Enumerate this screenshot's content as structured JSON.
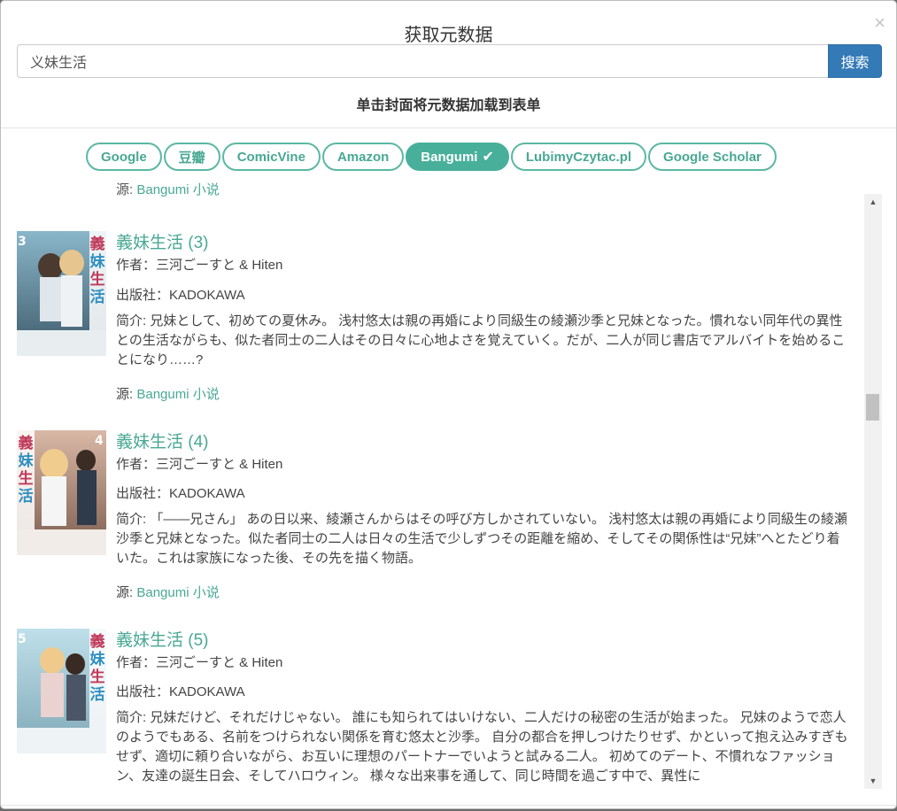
{
  "dialog": {
    "title": "获取元数据",
    "close": "×"
  },
  "search": {
    "value": "义妹生活",
    "button_label": "搜索"
  },
  "hint": "单击封面将元数据加载到表单",
  "sources": [
    {
      "label": "Google",
      "active": false
    },
    {
      "label": "豆瓣",
      "active": false
    },
    {
      "label": "ComicVine",
      "active": false
    },
    {
      "label": "Amazon",
      "active": false
    },
    {
      "label": "Bangumi",
      "active": true
    },
    {
      "label": "LubimyCzytac.pl",
      "active": false
    },
    {
      "label": "Google Scholar",
      "active": false
    }
  ],
  "partial": {
    "source_label": "源: ",
    "source_link": "Bangumi 小说"
  },
  "results": [
    {
      "title": "義妹生活 (3)",
      "author": "作者：三河ごーすと & Hiten",
      "publisher": "出版社：KADOKAWA",
      "description": "简介: 兄妹として、初めての夏休み。 浅村悠太は親の再婚により同級生の綾瀬沙季と兄妹となった。慣れない同年代の異性との生活ながらも、似た者同士の二人はその日々に心地よさを覚えていく。だが、二人が同じ書店でアルバイトを始めることになり……?",
      "source_label": "源: ",
      "source_link": "Bangumi 小说",
      "cover_number": "3"
    },
    {
      "title": "義妹生活 (4)",
      "author": "作者：三河ごーすと & Hiten",
      "publisher": "出版社：KADOKAWA",
      "description": "简介: 「——兄さん」 あの日以来、綾瀬さんからはその呼び方しかされていない。 浅村悠太は親の再婚により同級生の綾瀬沙季と兄妹となった。似た者同士の二人は日々の生活で少しずつその距離を縮め、そしてその関係性は“兄妹”へとたどり着いた。これは家族になった後、その先を描く物語。",
      "source_label": "源: ",
      "source_link": "Bangumi 小说",
      "cover_number": "4"
    },
    {
      "title": "義妹生活 (5)",
      "author": "作者：三河ごーすと & Hiten",
      "publisher": "出版社：KADOKAWA",
      "description": "简介: 兄妹だけど、それだけじゃない。 誰にも知られてはいけない、二人だけの秘密の生活が始まった。 兄妹のようで恋人のようでもある、名前をつけられない関係を育む悠太と沙季。 自分の都合を押しつけたりせず、かといって抱え込みすぎもせず、適切に頼り合いながら、お互いに理想のパートナーでいようと試みる二人。 初めてのデート、不慣れなファッション、友達の誕生日会、そしてハロウィン。 様々な出来事を通して、同じ時間を過ごす中で、異性に",
      "cover_number": "5"
    }
  ],
  "cover_title_vertical": "義妹生活"
}
